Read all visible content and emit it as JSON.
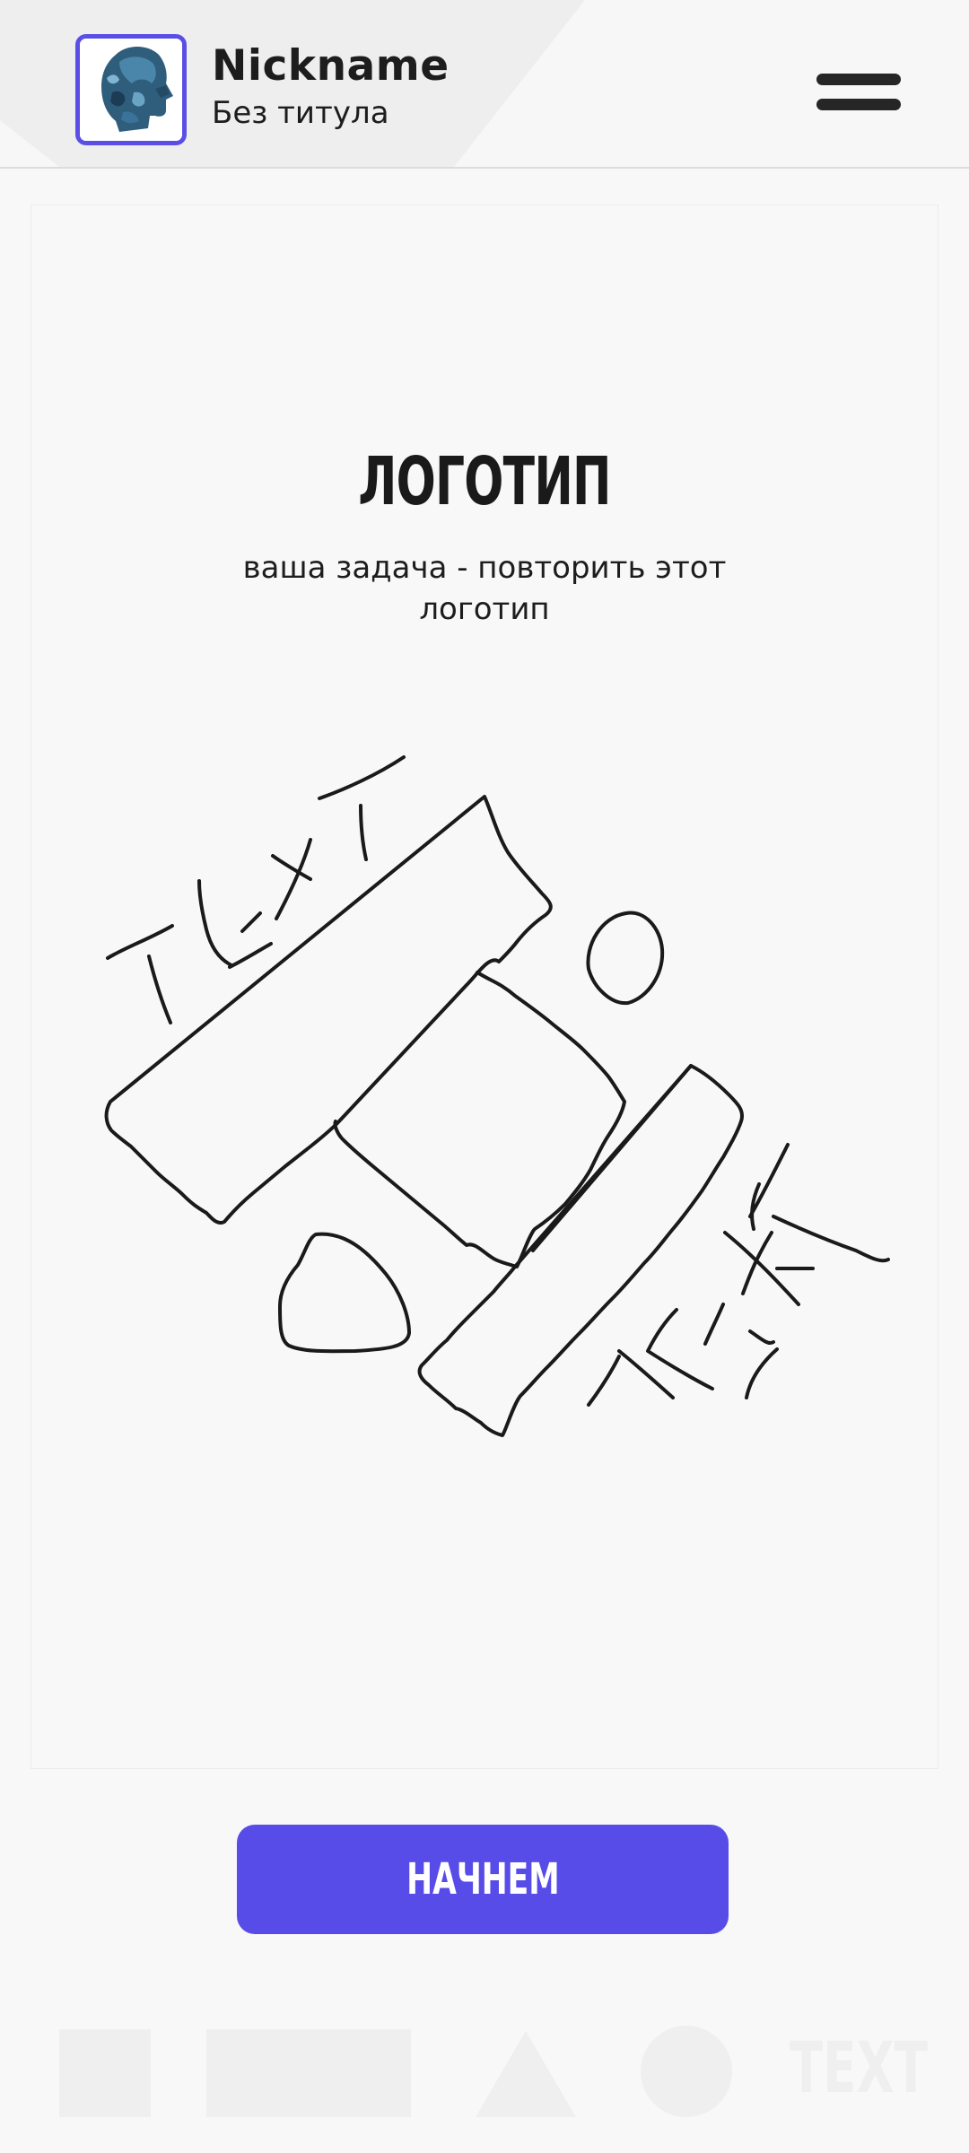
{
  "header": {
    "nickname": "Nickname",
    "title": "Без титула",
    "avatar_icon": "head-avatar-icon",
    "menu_icon": "hamburger-menu-icon",
    "accent_color": "#5a4ee6"
  },
  "task": {
    "heading": "ЛОГОТИП",
    "description": "ваша задача - повторить этот логотип",
    "sketch_text_1": "TEXT",
    "sketch_text_2": "TEXT"
  },
  "actions": {
    "start_label": "НАЧНЕМ",
    "button_color": "#574ce8"
  },
  "tools": {
    "items": [
      "square-tool-icon",
      "rectangle-tool-icon",
      "triangle-tool-icon",
      "circle-tool-icon",
      "text-tool"
    ],
    "text_label": "TEXT"
  }
}
